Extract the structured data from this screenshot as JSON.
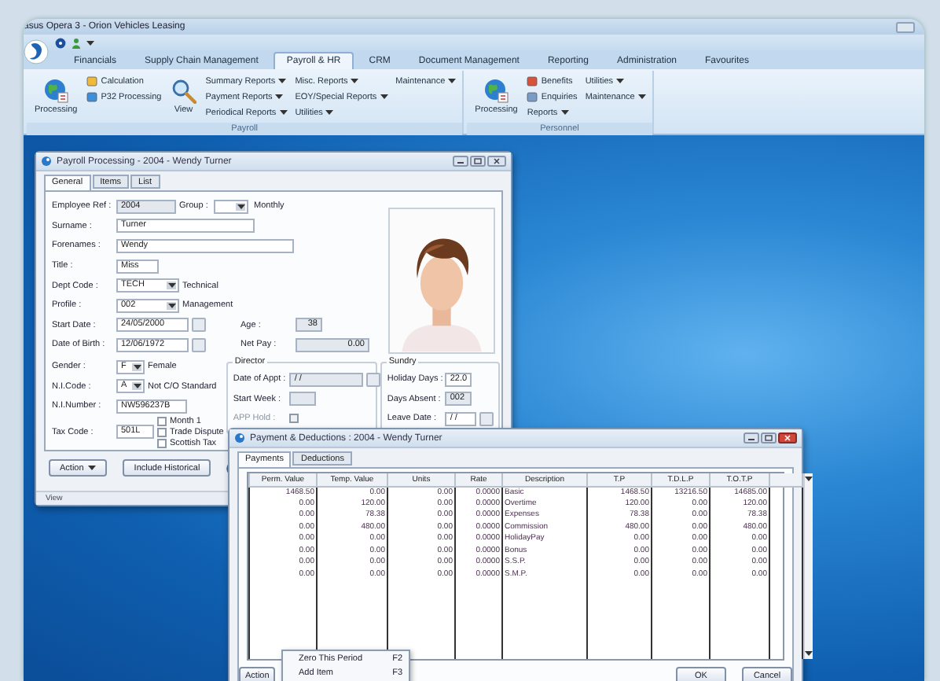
{
  "app": {
    "title": "asus Opera 3 - Orion Vehicles Leasing"
  },
  "ribbon_tabs": [
    {
      "label": "Financials",
      "selected": false
    },
    {
      "label": "Supply Chain Management",
      "selected": false
    },
    {
      "label": "Payroll & HR",
      "selected": true
    },
    {
      "label": "CRM",
      "selected": false
    },
    {
      "label": "Document Management",
      "selected": false
    },
    {
      "label": "Reporting",
      "selected": false
    },
    {
      "label": "Administration",
      "selected": false
    },
    {
      "label": "Favourites",
      "selected": false
    }
  ],
  "ribbon_groups": [
    {
      "label": "Payroll",
      "columns": [
        [
          {
            "kind": "process",
            "label": "Processing"
          }
        ],
        [
          {
            "kind": "small",
            "label": "Calculation"
          },
          {
            "kind": "small",
            "label": "P32 Processing"
          }
        ],
        [
          {
            "kind": "view",
            "label": "View"
          }
        ],
        [
          {
            "kind": "menu",
            "label": "Summary Reports"
          },
          {
            "kind": "menu",
            "label": "Payment Reports"
          },
          {
            "kind": "menu",
            "label": "Periodical Reports"
          }
        ],
        [
          {
            "kind": "menu",
            "label": "Misc. Reports"
          },
          {
            "kind": "menu",
            "label": "EOY/Special Reports"
          },
          {
            "kind": "menu",
            "label": "Utilities"
          }
        ],
        [
          {
            "kind": "menu",
            "label": "Maintenance"
          }
        ]
      ]
    },
    {
      "label": "Personnel",
      "columns": [
        [
          {
            "kind": "process",
            "label": "Processing"
          }
        ],
        [
          {
            "kind": "small",
            "label": "Benefits"
          },
          {
            "kind": "small",
            "label": "Enquiries"
          },
          {
            "kind": "menu",
            "label": "Reports"
          }
        ],
        [
          {
            "kind": "menu",
            "label": "Utilities"
          },
          {
            "kind": "menu",
            "label": "Maintenance"
          }
        ]
      ]
    }
  ],
  "payroll_window": {
    "title": "Payroll Processing - 2004 - Wendy Turner",
    "tabs": [
      {
        "label": "General",
        "selected": true
      },
      {
        "label": "Items",
        "selected": false
      },
      {
        "label": "List",
        "selected": false
      }
    ],
    "rows": [
      {
        "label": "Employee Ref :",
        "kind": "readonly",
        "value": "2004",
        "extra": {
          "label": "Group :",
          "kind": "dropdown",
          "note": "Monthly"
        }
      },
      {
        "label": "Surname :",
        "kind": "text",
        "value": "Turner"
      },
      {
        "label": "Forenames :",
        "kind": "text",
        "value": "Wendy"
      },
      {
        "label": "Title :",
        "kind": "text",
        "value": "Miss"
      },
      {
        "label": "Dept Code :",
        "kind": "dropdown",
        "value": "TECH",
        "note": "Technical"
      },
      {
        "label": "Profile :",
        "kind": "dropdown",
        "value": "002",
        "note": "Management"
      },
      {
        "label": "Start Date :",
        "kind": "date",
        "value": "24/05/2000",
        "side": {
          "label": "Age :",
          "value": "38"
        }
      },
      {
        "label": "Date of Birth :",
        "kind": "date",
        "value": "12/06/1972",
        "side": {
          "label": "Net Pay :",
          "value": "0.00"
        }
      },
      {
        "label": "Gender :",
        "kind": "dropdown",
        "value": "F",
        "note": "Female"
      },
      {
        "label": "N.I.Code :",
        "kind": "dropdown",
        "value": "A",
        "note": "Not C/O Standard"
      },
      {
        "label": "N.I.Number :",
        "kind": "text",
        "value": "NW596237B"
      },
      {
        "label": "Tax Code :",
        "kind": "text",
        "value": "501L",
        "checkboxes": [
          {
            "label": "Month 1",
            "checked": false
          },
          {
            "label": "Trade Dispute",
            "checked": false
          },
          {
            "label": "Scottish Tax",
            "checked": false
          }
        ]
      }
    ],
    "director": {
      "title": "Director",
      "date_of_appt": {
        "label": "Date of Appt :",
        "value": "/ /"
      },
      "start_week": {
        "label": "Start Week :"
      },
      "app_hold": {
        "label": "APP Hold :",
        "checked": false,
        "disabled": true
      }
    },
    "sundry": {
      "title": "Sundry",
      "fields": [
        {
          "label": "Holiday Days :",
          "kind": "text",
          "value": "22.0"
        },
        {
          "label": "Days Absent :",
          "kind": "readonly",
          "value": "002"
        },
        {
          "label": "Leave Date :",
          "kind": "date",
          "value": "/ /"
        }
      ]
    },
    "buttons": [
      {
        "kind": "menu",
        "label": "Action"
      },
      {
        "kind": "plain",
        "label": "Include Historical"
      },
      {
        "kind": "help"
      }
    ],
    "status_bar": "View"
  },
  "payments_window": {
    "title": "Payment & Deductions : 2004 - Wendy Turner",
    "tabs": [
      {
        "label": "Payments",
        "selected": true
      },
      {
        "label": "Deductions",
        "selected": false
      }
    ],
    "columns": [
      "Perm. Value",
      "Temp. Value",
      "Units",
      "Rate",
      "Description",
      "T.P",
      "T.D.L.P",
      "T.O.T.P"
    ],
    "rows": [
      [
        "1468.50",
        "0.00",
        "0.00",
        "0.0000",
        "Basic",
        "1468.50",
        "13216.50",
        "14685.00"
      ],
      [
        "0.00",
        "120.00",
        "0.00",
        "0.0000",
        "Overtime",
        "120.00",
        "0.00",
        "120.00"
      ],
      [
        "0.00",
        "78.38",
        "0.00",
        "0.0000",
        "Expenses",
        "78.38",
        "0.00",
        "78.38"
      ],
      [
        "0.00",
        "480.00",
        "0.00",
        "0.0000",
        "Commission",
        "480.00",
        "0.00",
        "480.00"
      ],
      [
        "0.00",
        "0.00",
        "0.00",
        "0.0000",
        "HolidayPay",
        "0.00",
        "0.00",
        "0.00"
      ],
      [
        "0.00",
        "0.00",
        "0.00",
        "0.0000",
        "Bonus",
        "0.00",
        "0.00",
        "0.00"
      ],
      [
        "0.00",
        "0.00",
        "0.00",
        "0.0000",
        "S.S.P.",
        "0.00",
        "0.00",
        "0.00"
      ],
      [
        "0.00",
        "0.00",
        "0.00",
        "0.0000",
        "S.M.P.",
        "0.00",
        "0.00",
        "0.00"
      ]
    ],
    "action_button": "Action",
    "action_menu": [
      {
        "label": "Zero This Period",
        "shortcut": "F2"
      },
      {
        "label": "Add Item",
        "shortcut": "F3"
      }
    ],
    "buttons": [
      "OK",
      "Cancel"
    ]
  }
}
